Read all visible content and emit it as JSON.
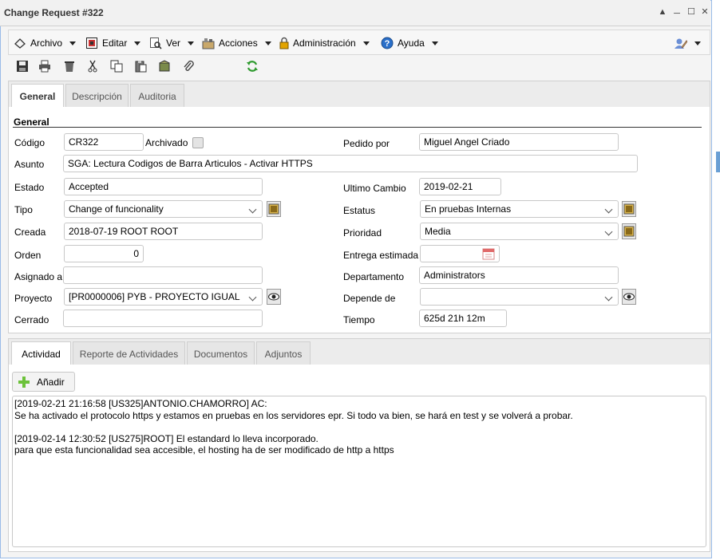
{
  "window": {
    "title": "Change Request #322"
  },
  "menu": {
    "archivo": "Archivo",
    "editar": "Editar",
    "ver": "Ver",
    "acciones": "Acciones",
    "administracion": "Administración",
    "ayuda": "Ayuda"
  },
  "tabs_main": [
    "General",
    "Descripción",
    "Auditoria"
  ],
  "form": {
    "section": "General",
    "codigo_label": "Código",
    "codigo": "CR322",
    "archivado_label": "Archivado",
    "pedido_label": "Pedido por",
    "pedido": "Miguel Angel Criado",
    "asunto_label": "Asunto",
    "asunto": "SGA: Lectura Codigos de Barra Articulos - Activar HTTPS",
    "estado_label": "Estado",
    "estado": "Accepted",
    "ultimo_label": "Ultimo Cambio",
    "ultimo": "2019-02-21",
    "tipo_label": "Tipo",
    "tipo": "Change of funcionality",
    "estatus_label": "Estatus",
    "estatus": "En pruebas Internas",
    "creada_label": "Creada",
    "creada": "2018-07-19 ROOT ROOT",
    "prioridad_label": "Prioridad",
    "prioridad": "Media",
    "orden_label": "Orden",
    "orden": "0",
    "entrega_label": "Entrega estimada",
    "entrega": "",
    "asignado_label": "Asignado a",
    "asignado": "",
    "departamento_label": "Departamento",
    "departamento": "Administrators",
    "proyecto_label": "Proyecto",
    "proyecto": "[PR0000006] PYB - PROYECTO IGUAL",
    "depende_label": "Depende de",
    "depende": "",
    "cerrado_label": "Cerrado",
    "cerrado": "",
    "tiempo_label": "Tiempo",
    "tiempo": "625d 21h 12m"
  },
  "tabs_bottom": [
    "Actividad",
    "Reporte de Actividades",
    "Documentos",
    "Adjuntos"
  ],
  "activity": {
    "add_label": "Añadir",
    "lines": [
      "[2019-02-21 21:16:58 [US325]ANTONIO.CHAMORRO] AC:",
      "Se ha activado el protocolo https y estamos en pruebas en los servidores epr. Si todo va bien, se hará en test y se volverá a probar.",
      "",
      "[2019-02-14 12:30:52 [US275]ROOT] El estandard lo lleva incorporado.",
      "para que esta funcionalidad sea accesible, el hosting ha de ser modificado de http a https"
    ]
  }
}
